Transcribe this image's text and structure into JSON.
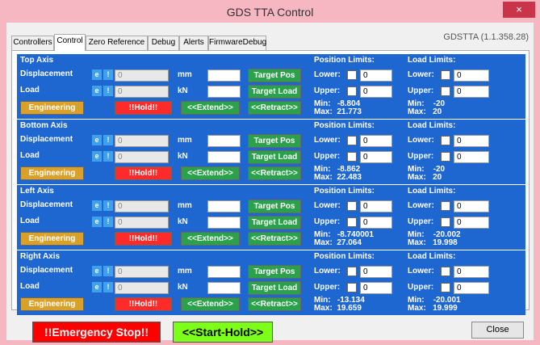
{
  "window": {
    "title": "GDS TTA Control",
    "close_label": "×"
  },
  "tabs": [
    "Controllers",
    "Control",
    "Zero Reference",
    "Debug",
    "Alerts",
    "FirmwareDebug"
  ],
  "version": "GDSTTA (1.1.358.28)",
  "labels": {
    "displacement": "Displacement",
    "load": "Load",
    "mm": "mm",
    "kn": "kN",
    "e_icon": "e",
    "i_icon": "!",
    "target_pos": "Target Pos",
    "target_load": "Target Load",
    "position_limits": "Position Limits:",
    "load_limits": "Load Limits:",
    "lower": "Lower:",
    "upper": "Upper:",
    "engineering": "Engineering",
    "hold": "!!Hold!!",
    "extend": "<<Extend>>",
    "retract": "<<Retract>>"
  },
  "axes": [
    {
      "name": "Top Axis",
      "displacement_value": "0",
      "load_value": "0",
      "pos_lower": "0",
      "pos_upper": "0",
      "load_lower": "0",
      "load_upper": "0",
      "pos_minmax": "Min:   -8.804\nMax:  21.773",
      "load_minmax": "Min:    -20\nMax:   20"
    },
    {
      "name": "Bottom Axis",
      "displacement_value": "0",
      "load_value": "0",
      "pos_lower": "0",
      "pos_upper": "0",
      "load_lower": "0",
      "load_upper": "0",
      "pos_minmax": "Min:   -8.862\nMax:  22.483",
      "load_minmax": "Min:    -20\nMax:   20"
    },
    {
      "name": "Left Axis",
      "displacement_value": "0",
      "load_value": "0",
      "pos_lower": "0",
      "pos_upper": "0",
      "load_lower": "0",
      "load_upper": "0",
      "pos_minmax": "Min:   -8.740001\nMax:  27.064",
      "load_minmax": "Min:    -20.002\nMax:   19.998"
    },
    {
      "name": "Right Axis",
      "displacement_value": "0",
      "load_value": "0",
      "pos_lower": "0",
      "pos_upper": "0",
      "load_lower": "0",
      "load_upper": "0",
      "pos_minmax": "Min:   -13.134\nMax:  19.659",
      "load_minmax": "Min:    -20.001\nMax:   19.999"
    }
  ],
  "footer": {
    "emergency_stop": "!!Emergency Stop!!",
    "start_hold": "<<Start-Hold>>",
    "close": "Close"
  },
  "colors": {
    "panel_bg": "#1f67d0",
    "green_button": "#2aa14a",
    "red_button": "#ff2a2a",
    "engineering_button": "#d9a02a",
    "start_hold_bg": "#7dff1a",
    "titlebar_bg": "#f7b7c2"
  }
}
